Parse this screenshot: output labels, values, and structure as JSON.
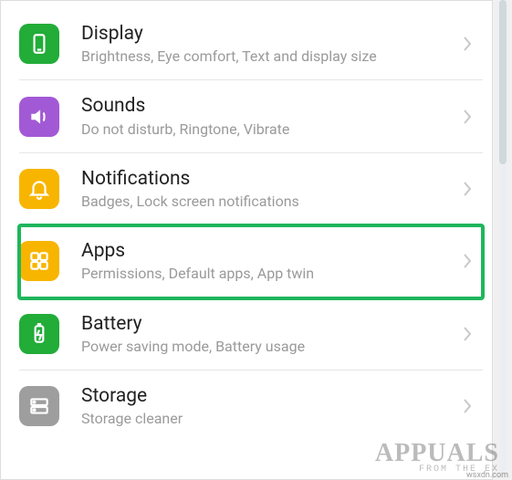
{
  "settings": {
    "items": [
      {
        "id": "display",
        "title": "Display",
        "subtitle": "Brightness, Eye comfort, Text and display size",
        "icon": "display-icon",
        "color": "#22ac38",
        "highlighted": false
      },
      {
        "id": "sounds",
        "title": "Sounds",
        "subtitle": "Do not disturb, Ringtone, Vibrate",
        "icon": "speaker-icon",
        "color": "#a259d6",
        "highlighted": false
      },
      {
        "id": "notifications",
        "title": "Notifications",
        "subtitle": "Badges, Lock screen notifications",
        "icon": "bell-icon",
        "color": "#f8b500",
        "highlighted": false
      },
      {
        "id": "apps",
        "title": "Apps",
        "subtitle": "Permissions, Default apps, App twin",
        "icon": "apps-icon",
        "color": "#f8b500",
        "highlighted": true
      },
      {
        "id": "battery",
        "title": "Battery",
        "subtitle": "Power saving mode, Battery usage",
        "icon": "battery-icon",
        "color": "#22ac38",
        "highlighted": false
      },
      {
        "id": "storage",
        "title": "Storage",
        "subtitle": "Storage cleaner",
        "icon": "storage-icon",
        "color": "#9e9e9e",
        "highlighted": false
      }
    ]
  },
  "watermark": {
    "main": "APPUALS",
    "sub": "FROM THE EX",
    "url": "wsxdn.com"
  }
}
